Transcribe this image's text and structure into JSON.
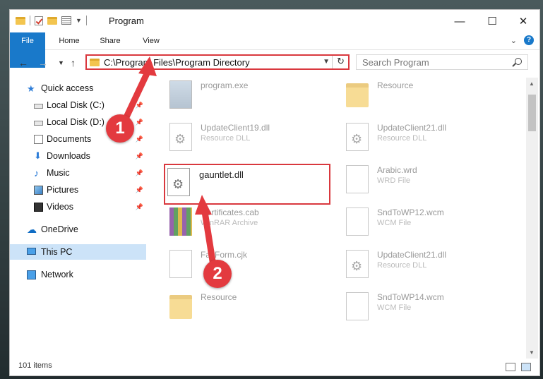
{
  "window": {
    "title": "Program",
    "controls": {
      "minimize": "—",
      "maximize": "☐",
      "close": "✕"
    }
  },
  "ribbon": {
    "tabs": [
      "File",
      "Home",
      "Share",
      "View"
    ],
    "help": "?"
  },
  "address": {
    "path": "C:\\Program Files\\Program Directory",
    "search_placeholder": "Search Program"
  },
  "sidebar": {
    "items": [
      {
        "label": "Quick access",
        "icon": "star-icon"
      },
      {
        "label": "Local Disk (C:)",
        "icon": "disk-icon",
        "pinned": true
      },
      {
        "label": "Local Disk (D:)",
        "icon": "disk-icon",
        "pinned": true
      },
      {
        "label": "Documents",
        "icon": "documents-icon",
        "pinned": true
      },
      {
        "label": "Downloads",
        "icon": "download-icon",
        "pinned": true
      },
      {
        "label": "Music",
        "icon": "music-icon",
        "pinned": true
      },
      {
        "label": "Pictures",
        "icon": "pictures-icon",
        "pinned": true
      },
      {
        "label": "Videos",
        "icon": "videos-icon",
        "pinned": true
      },
      {
        "label": "OneDrive",
        "icon": "cloud-icon"
      },
      {
        "label": "This PC",
        "icon": "computer-icon",
        "selected": true
      },
      {
        "label": "Network",
        "icon": "network-icon"
      }
    ]
  },
  "files": [
    {
      "name": "program.exe",
      "type": "",
      "icon": "exe-icon"
    },
    {
      "name": "Resource",
      "type": "",
      "icon": "folder-icon"
    },
    {
      "name": "UpdateClient19.dll",
      "type": "Resource DLL",
      "icon": "dll-icon"
    },
    {
      "name": "UpdateClient21.dll",
      "type": "Resource DLL",
      "icon": "dll-icon"
    },
    {
      "name": "gauntlet.dll",
      "type": "",
      "icon": "dll-icon"
    },
    {
      "name": "Arabic.wrd",
      "type": "WRD File",
      "icon": "file-icon"
    },
    {
      "name": "Certificates.cab",
      "type": "WinRAR Archive",
      "icon": "rar-icon"
    },
    {
      "name": "SndToWP12.wcm",
      "type": "WCM File",
      "icon": "file-icon"
    },
    {
      "name": "FaxForm.cjk",
      "type": "",
      "icon": "file-icon"
    },
    {
      "name": "UpdateClient21.dll",
      "type": "Resource DLL",
      "icon": "dll-icon"
    },
    {
      "name": "Resource",
      "type": "",
      "icon": "folder-icon"
    },
    {
      "name": "SndToWP14.wcm",
      "type": "WCM File",
      "icon": "file-icon"
    }
  ],
  "status": {
    "count": "101 items"
  },
  "callouts": {
    "one": "1",
    "two": "2"
  },
  "colors": {
    "accent": "#1979ca",
    "highlight": "#d9383e",
    "badge": "#e33a3f"
  }
}
